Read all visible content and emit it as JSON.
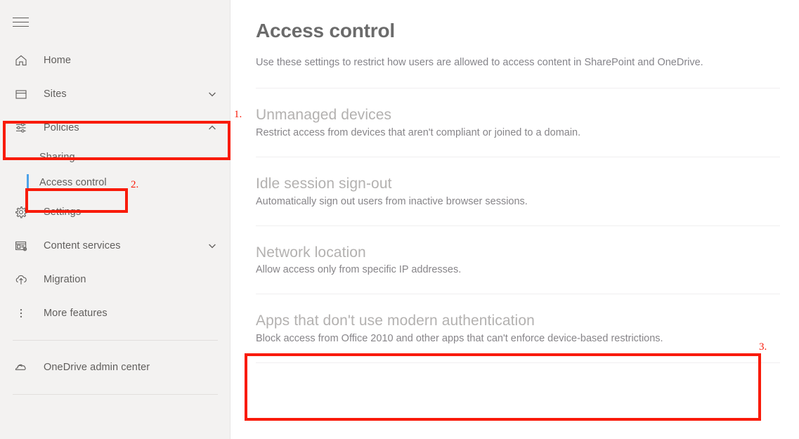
{
  "sidebar": {
    "menu_toggle": "hamburger-menu",
    "items": [
      {
        "label": "Home",
        "icon": "home-icon",
        "chevron": "",
        "type": "item"
      },
      {
        "label": "Sites",
        "icon": "sites-icon",
        "chevron": "⌄",
        "type": "item"
      },
      {
        "label": "Policies",
        "icon": "policies-sliders-icon",
        "chevron": "⌃",
        "type": "item"
      },
      {
        "label": "Sharing",
        "icon": "",
        "chevron": "",
        "type": "sub"
      },
      {
        "label": "Access control",
        "icon": "",
        "chevron": "",
        "type": "sub-selected"
      },
      {
        "label": "Settings",
        "icon": "gear-icon",
        "chevron": "",
        "type": "item"
      },
      {
        "label": "Content services",
        "icon": "content-services-icon",
        "chevron": "⌄",
        "type": "item"
      },
      {
        "label": "Migration",
        "icon": "cloud-upload-icon",
        "chevron": "",
        "type": "item"
      },
      {
        "label": "More features",
        "icon": "more-dots-icon",
        "chevron": "",
        "type": "item"
      }
    ],
    "footer_item": {
      "label": "OneDrive admin center",
      "icon": "onedrive-cloud-icon"
    }
  },
  "main": {
    "title": "Access control",
    "subtitle": "Use these settings to restrict how users are allowed to access content in SharePoint and OneDrive.",
    "cards": [
      {
        "title": "Unmanaged devices",
        "desc": "Restrict access from devices that aren't compliant or joined to a domain."
      },
      {
        "title": "Idle session sign-out",
        "desc": "Automatically sign out users from inactive browser sessions."
      },
      {
        "title": "Network location",
        "desc": "Allow access only from specific IP addresses."
      },
      {
        "title": "Apps that don't use modern authentication",
        "desc": "Block access from Office 2010 and other apps that can't enforce device-based restrictions."
      }
    ]
  },
  "annotations": {
    "color": "#f91b09",
    "markers": [
      {
        "id": "1",
        "label": "1.",
        "target": "sidebar-item-policies"
      },
      {
        "id": "2",
        "label": "2.",
        "target": "sidebar-item-access-control"
      },
      {
        "id": "3",
        "label": "3.",
        "target": "card-apps-modern-auth"
      }
    ]
  }
}
